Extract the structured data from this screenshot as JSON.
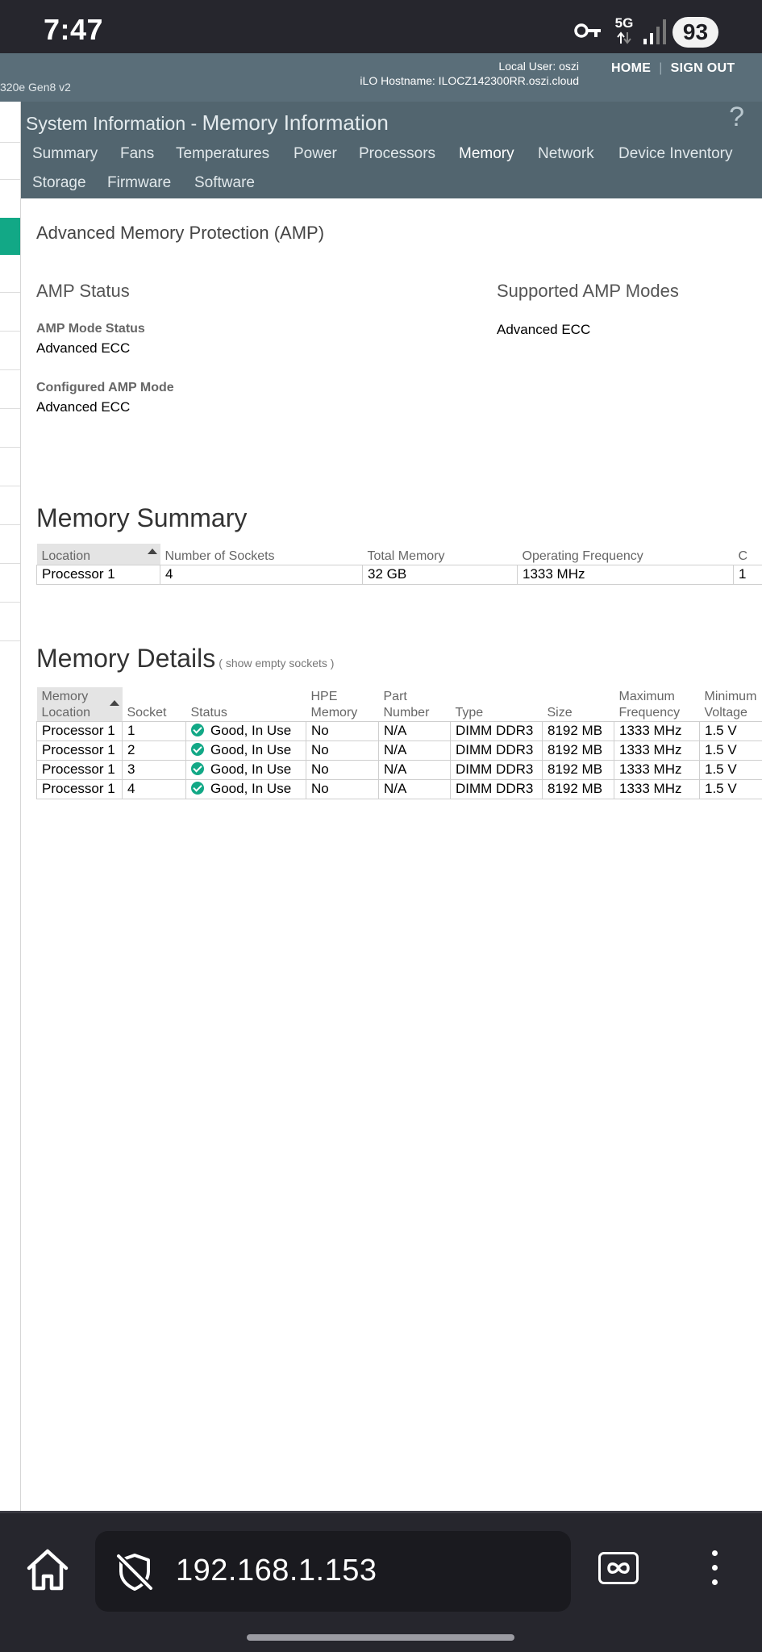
{
  "status_bar": {
    "time": "7:47",
    "network": "5G",
    "battery": "93",
    "icons": [
      "vpn-key-icon",
      "signal-5g-icon",
      "signal-strength-icon",
      "battery-icon"
    ]
  },
  "ilo_header": {
    "server_name": "320e Gen8 v2",
    "local_user": "Local User: oszi",
    "hostname": "iLO Hostname: ILOCZ142300RR.oszi.cloud",
    "home_link": "HOME",
    "sign_out_link": "SIGN OUT",
    "separator": "|"
  },
  "page_header": {
    "section": "System Information",
    "dash": " - ",
    "page": "Memory Information",
    "help": "?",
    "active_tab": "Memory",
    "tabs": [
      "Summary",
      "Fans",
      "Temperatures",
      "Power",
      "Processors",
      "Memory",
      "Network",
      "Device Inventory",
      "Storage",
      "Firmware",
      "Software"
    ]
  },
  "amp": {
    "title": "Advanced Memory Protection (AMP)",
    "status_heading": "AMP Status",
    "mode_status_label": "AMP Mode Status",
    "mode_status_value": "Advanced ECC",
    "configured_label": "Configured AMP Mode",
    "configured_value": "Advanced ECC",
    "supported_heading": "Supported AMP Modes",
    "supported_value": "Advanced ECC"
  },
  "memory_summary": {
    "title": "Memory Summary",
    "columns": [
      "Location",
      "Number of Sockets",
      "Total Memory",
      "Operating Frequency",
      "C"
    ],
    "rows": [
      [
        "Processor 1",
        "4",
        "32 GB",
        "1333 MHz",
        "1"
      ]
    ]
  },
  "memory_details": {
    "title": "Memory Details",
    "show_empty_link": "( show empty sockets )",
    "columns": [
      [
        "Memory",
        "Location"
      ],
      [
        "",
        "Socket"
      ],
      [
        "",
        "Status"
      ],
      [
        "HPE",
        "Memory"
      ],
      [
        "Part",
        "Number"
      ],
      [
        "",
        "Type"
      ],
      [
        "",
        "Size"
      ],
      [
        "Maximum",
        "Frequency"
      ],
      [
        "Minimum",
        "Voltage"
      ]
    ],
    "rows": [
      [
        "Processor 1",
        "1",
        "Good, In Use",
        "No",
        "N/A",
        "DIMM DDR3",
        "8192 MB",
        "1333 MHz",
        "1.5 V"
      ],
      [
        "Processor 1",
        "2",
        "Good, In Use",
        "No",
        "N/A",
        "DIMM DDR3",
        "8192 MB",
        "1333 MHz",
        "1.5 V"
      ],
      [
        "Processor 1",
        "3",
        "Good, In Use",
        "No",
        "N/A",
        "DIMM DDR3",
        "8192 MB",
        "1333 MHz",
        "1.5 V"
      ],
      [
        "Processor 1",
        "4",
        "Good, In Use",
        "No",
        "N/A",
        "DIMM DDR3",
        "8192 MB",
        "1333 MHz",
        "1.5 V"
      ]
    ]
  },
  "browser": {
    "url": "192.168.1.153",
    "icons": [
      "home-icon",
      "shield-off-icon",
      "tabs-icon",
      "more-menu-icon"
    ]
  },
  "colors": {
    "status_bar": "#26262d",
    "ilo_header": "#5a6e79",
    "ilo_nav": "#52656f",
    "accent_green": "#12a886"
  }
}
